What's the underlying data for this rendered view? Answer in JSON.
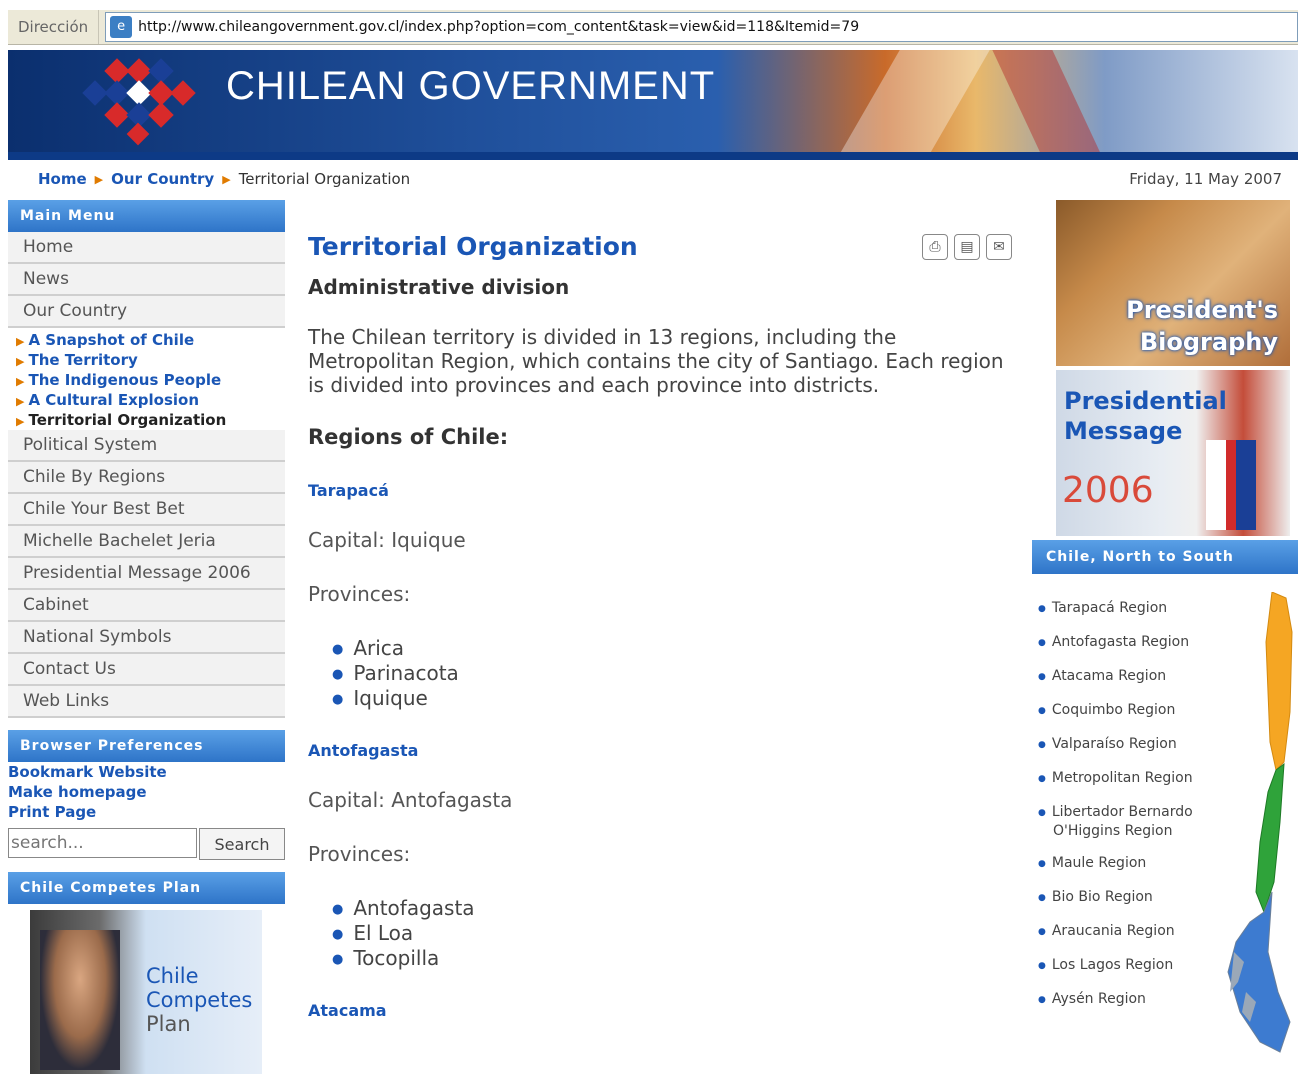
{
  "address_bar": {
    "label": "Dirección",
    "url": "http://www.chileangovernment.gov.cl/index.php?option=com_content&task=view&id=118&Itemid=79"
  },
  "header": {
    "brand": "CHILEAN GOVERNMENT"
  },
  "breadcrumb": {
    "home": "Home",
    "our_country": "Our Country",
    "current": "Territorial Organization"
  },
  "date": "Friday, 11 May 2007",
  "main_menu": {
    "title": "Main Menu",
    "items": [
      "Home",
      "News",
      "Our Country"
    ],
    "sub_items": [
      "A Snapshot of Chile",
      "The Territory",
      "The Indigenous People",
      "A Cultural Explosion",
      "Territorial Organization"
    ],
    "items_after": [
      "Political System",
      "Chile By Regions",
      "Chile Your Best Bet",
      "Michelle Bachelet Jeria",
      "Presidential Message 2006",
      "Cabinet",
      "National Symbols",
      "Contact Us",
      "Web Links"
    ]
  },
  "browser_prefs": {
    "title": "Browser Preferences",
    "links": [
      "Bookmark Website",
      "Make homepage",
      "Print Page"
    ]
  },
  "search": {
    "placeholder": "search...",
    "button": "Search"
  },
  "competes": {
    "title": "Chile Competes Plan",
    "line1": "Chile",
    "line2": "Competes",
    "line3": "Plan"
  },
  "article": {
    "title": "Territorial Organization",
    "subtitle": "Administrative division",
    "intro": "The Chilean territory is divided in 13 regions, including the Metropolitan Region, which contains the city of Santiago. Each region is divided into provinces and each province into districts.",
    "regions_heading": "Regions of Chile:",
    "regions": [
      {
        "name": "Tarapacá",
        "capital": "Capital: Iquique",
        "provinces_label": "Provinces:",
        "provinces": [
          "Arica",
          "Parinacota",
          "Iquique"
        ]
      },
      {
        "name": "Antofagasta",
        "capital": "Capital: Antofagasta",
        "provinces_label": "Provinces:",
        "provinces": [
          "Antofagasta",
          "El Loa",
          "Tocopilla"
        ]
      },
      {
        "name": "Atacama"
      }
    ]
  },
  "right": {
    "bio_line1": "President's",
    "bio_line2": "Biography",
    "msg_line1": "Presidential",
    "msg_line2": "Message",
    "msg_year": "2006",
    "map_title": "Chile, North to South",
    "regions": [
      "Tarapacá Region",
      "Antofagasta Region",
      "Atacama Region",
      "Coquimbo Region",
      "Valparaíso Region",
      "Metropolitan Region",
      "Libertador Bernardo",
      "Maule Region",
      "Bio Bio Region",
      "Araucania Region",
      "Los Lagos Region",
      "Aysén Region"
    ],
    "libertador_line2": "O'Higgins Region"
  },
  "colors": {
    "link_blue": "#1a56b5",
    "bar_blue": "#2e74c8",
    "arrow_orange": "#e07b00"
  }
}
